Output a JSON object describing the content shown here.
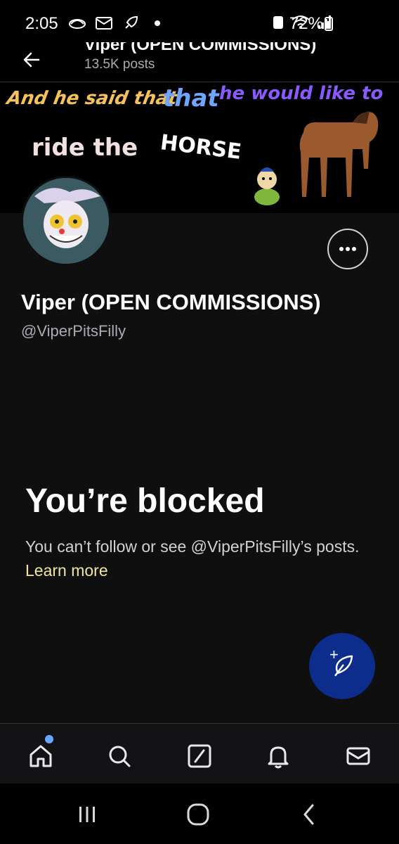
{
  "status_bar": {
    "time": "2:05",
    "battery": "72%"
  },
  "header": {
    "title": "Viper (OPEN COMMISSIONS)",
    "posts_count": "13.5K posts"
  },
  "banner": {
    "text_1": "And he said that",
    "text_2": "that",
    "text_3": "he would like to",
    "text_4": "ride the",
    "text_5": "HORSE"
  },
  "profile": {
    "name": "Viper (OPEN COMMISSIONS)",
    "handle": "@ViperPitsFilly"
  },
  "blocked": {
    "title": "You’re blocked",
    "message": "You can’t follow or see @ViperPitsFilly’s posts.",
    "learn_more": "Learn more"
  },
  "nav": {
    "items": [
      "home",
      "search",
      "grok",
      "notifications",
      "messages"
    ]
  },
  "colors": {
    "background": "#0f0f10",
    "learn_more": "#f0e59a",
    "fab": "#0d2d8d",
    "home_dot": "#66a8ff"
  }
}
